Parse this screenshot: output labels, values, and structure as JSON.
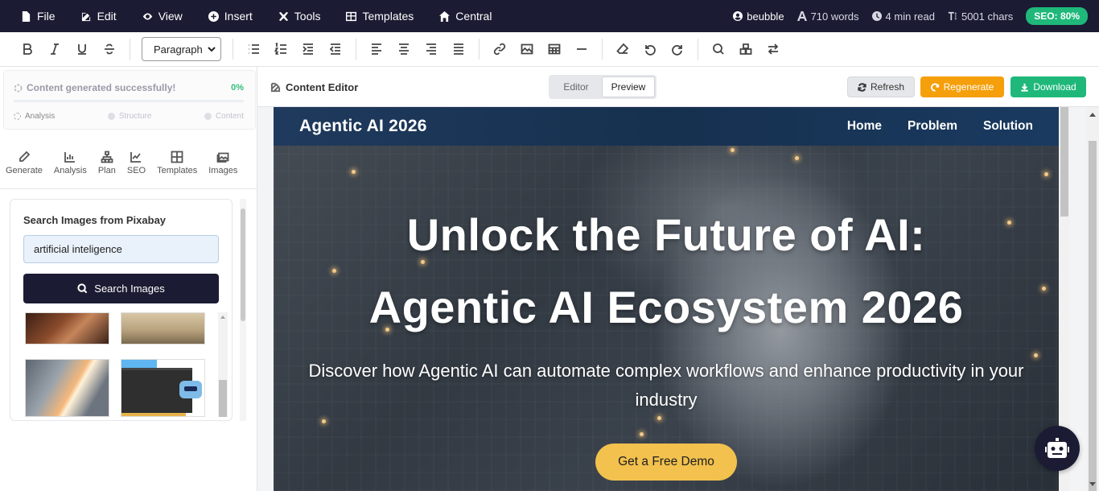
{
  "menubar": {
    "items": [
      {
        "label": "File",
        "icon": "file-icon"
      },
      {
        "label": "Edit",
        "icon": "edit-icon"
      },
      {
        "label": "View",
        "icon": "eye-icon"
      },
      {
        "label": "Insert",
        "icon": "plus-circle-icon"
      },
      {
        "label": "Tools",
        "icon": "tools-icon"
      },
      {
        "label": "Templates",
        "icon": "table-icon"
      },
      {
        "label": "Central",
        "icon": "home-icon"
      }
    ],
    "user": "beubble",
    "words": "710 words",
    "read_time": "4 min read",
    "chars": "5001 chars",
    "seo_badge": "SEO: 80%",
    "seo_color": "#1fb87a"
  },
  "toolbar": {
    "block_format": "Paragraph"
  },
  "status": {
    "message": "Content generated successfully!",
    "percent": "0%",
    "progress": 0,
    "steps": [
      "Analysis",
      "Structure",
      "Content"
    ]
  },
  "left_tabs": [
    {
      "label": "Generate",
      "icon": "pen-icon"
    },
    {
      "label": "Analysis",
      "icon": "bar-chart-icon"
    },
    {
      "label": "Plan",
      "icon": "sitemap-icon"
    },
    {
      "label": "SEO",
      "icon": "line-chart-icon"
    },
    {
      "label": "Templates",
      "icon": "grid-icon"
    },
    {
      "label": "Images",
      "icon": "images-icon"
    }
  ],
  "image_search": {
    "title": "Search Images from Pixabay",
    "query": "artificial inteligence",
    "button": "Search Images"
  },
  "editor": {
    "title": "Content Editor",
    "modes": [
      "Editor",
      "Preview"
    ],
    "active_mode": "Preview",
    "refresh": "Refresh",
    "regenerate": "Regenerate",
    "download": "Download",
    "regenerate_color": "#f59f0a",
    "download_color": "#1fb87a"
  },
  "preview": {
    "site_name": "Agentic AI 2026",
    "nav_links": [
      "Home",
      "Problem",
      "Solution"
    ],
    "hero_title_line1": "Unlock the Future of AI:",
    "hero_title_line2": "Agentic AI Ecosystem 2026",
    "hero_subtitle": "Discover how Agentic AI can automate complex workflows and enhance productivity in your industry",
    "cta": "Get a Free Demo",
    "cta_color": "#f2c14e"
  }
}
